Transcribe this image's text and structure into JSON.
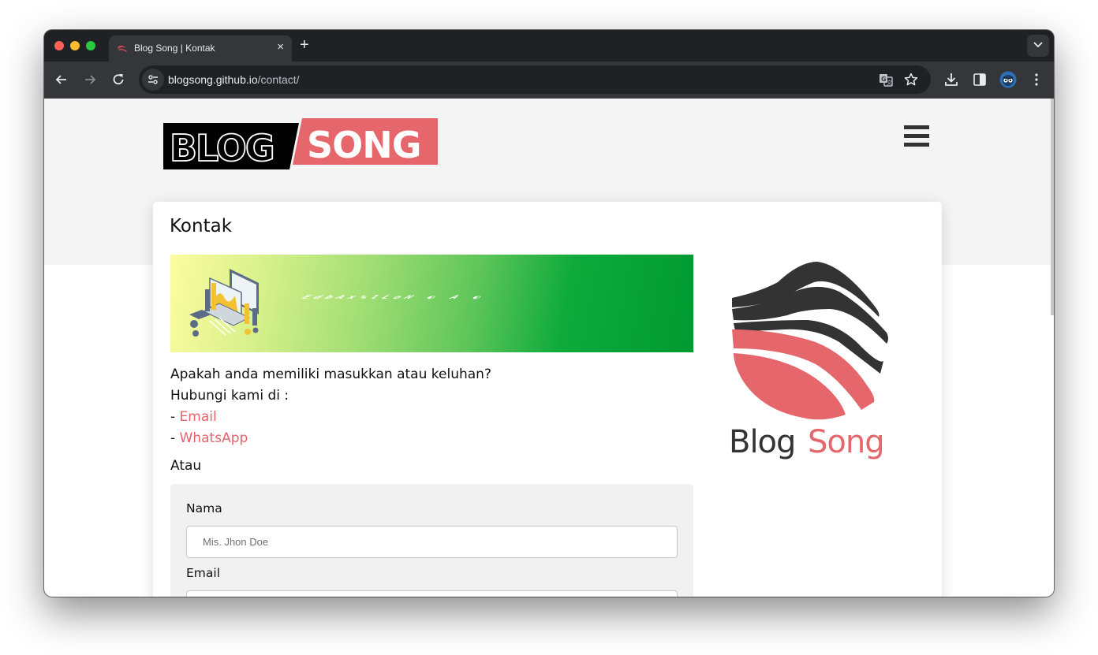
{
  "browser": {
    "tab": {
      "title": "Blog Song | Kontak",
      "close_label": "×",
      "favicon": "blogsong-favicon"
    },
    "new_tab_label": "+",
    "url": {
      "host": "blogsong.github.io",
      "path": "/contact/"
    },
    "icons": [
      "back-icon",
      "forward-icon",
      "reload-icon",
      "site-info-icon",
      "translate-icon",
      "bookmark-star-icon",
      "download-icon",
      "side-panel-icon",
      "profile-avatar-icon",
      "more-menu-icon",
      "tab-search-icon"
    ]
  },
  "site": {
    "logo": {
      "left": "BLOG",
      "right": "SONG"
    },
    "menu_icon": "hamburger-menu-icon",
    "brand_color": "#e5646a"
  },
  "page": {
    "title": "Kontak",
    "banner_alt": "Contact banner with analytics illustration",
    "intro": "Apakah anda memiliki masukkan atau keluhan?",
    "contact_lead": "Hubungi kami di :",
    "links": [
      {
        "prefix": "- ",
        "label": "Email"
      },
      {
        "prefix": "- ",
        "label": "WhatsApp"
      }
    ],
    "or_label": "Atau",
    "form": {
      "name_label": "Nama",
      "name_placeholder": "Mis. Jhon Doe",
      "name_value": "",
      "email_label": "Email",
      "email_placeholder": "",
      "email_value": ""
    },
    "side_logo": {
      "left": "Blog",
      "right": "Song"
    }
  }
}
